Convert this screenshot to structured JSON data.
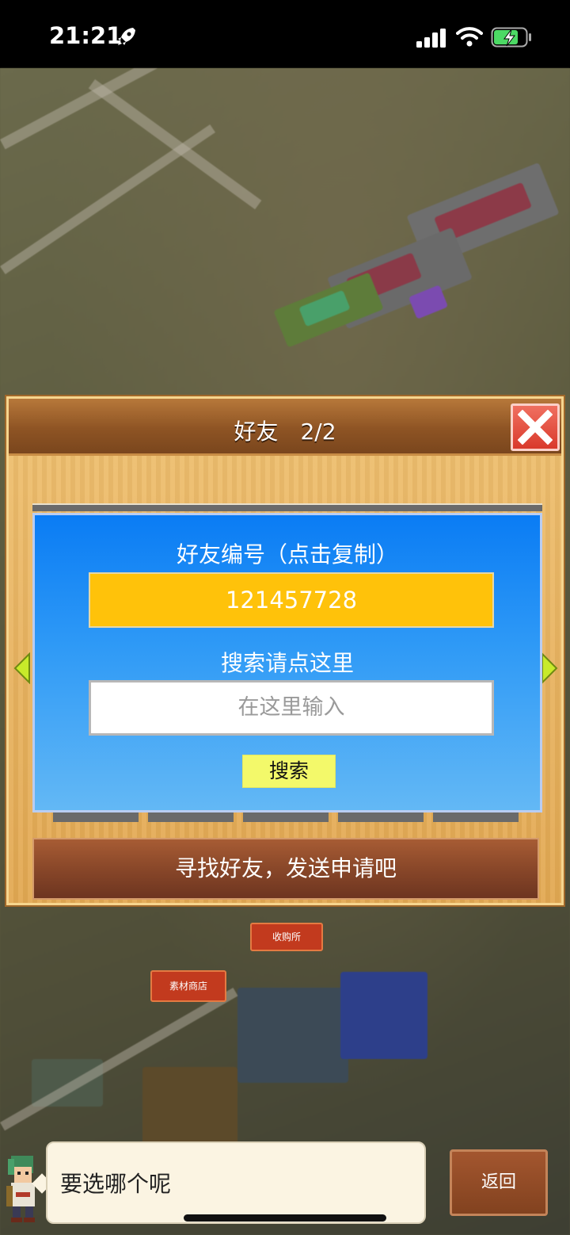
{
  "status_bar": {
    "time": "21:21"
  },
  "dialog": {
    "title": "好友　2/2",
    "panel": {
      "friend_id_label": "好友编号（点击复制）",
      "friend_id": "121457728",
      "search_label": "搜索请点这里",
      "search_placeholder": "在这里输入",
      "search_button": "搜索"
    },
    "find_friends_banner": "寻找好友，发送申请吧"
  },
  "map": {
    "labels": [
      "收购所",
      "素材商店"
    ]
  },
  "chat": {
    "message": "要选哪个呢",
    "back_button": "返回"
  },
  "colors": {
    "panel_top": "#0a7cf4",
    "id_box": "#ffc20a",
    "search_button": "#f3f96a",
    "close_button": "#d93a2c"
  }
}
